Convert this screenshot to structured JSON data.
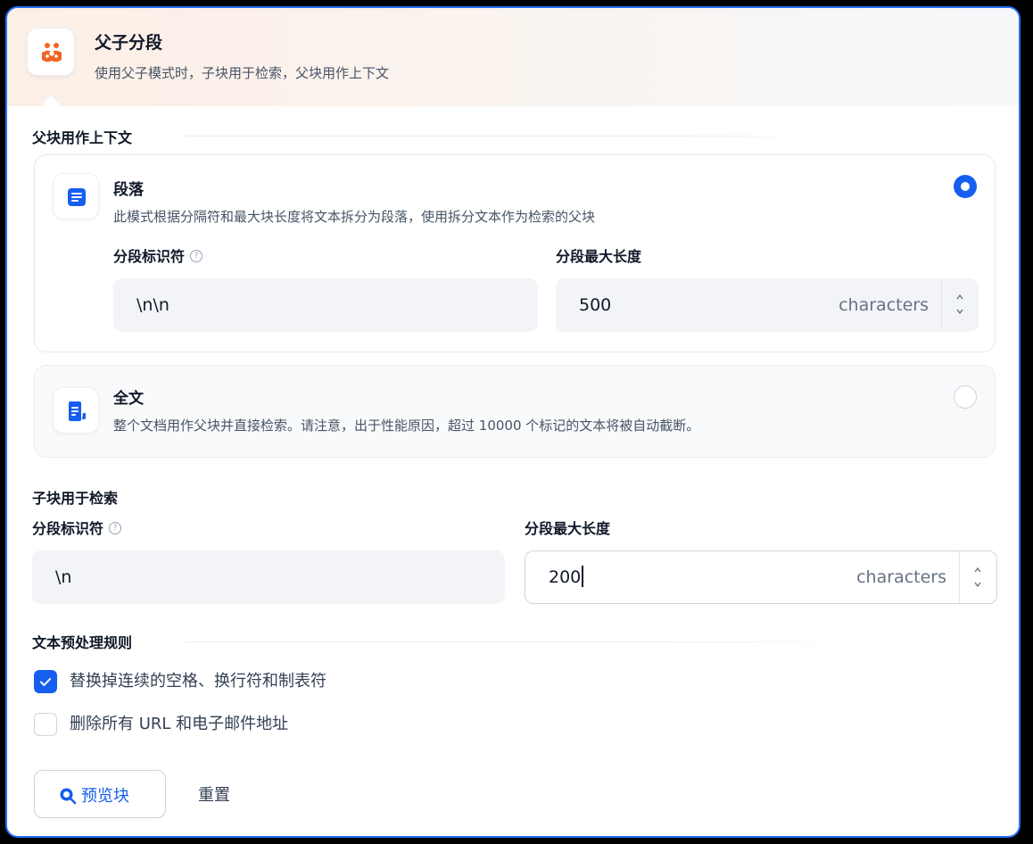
{
  "header": {
    "title": "父子分段",
    "description": "使用父子模式时，子块用于检索，父块用作上下文",
    "icon": "parent-child-icon",
    "accent_color": "#f06525"
  },
  "parent_section": {
    "title": "父块用作上下文",
    "options": [
      {
        "title": "段落",
        "description": "此模式根据分隔符和最大块长度将文本拆分为段落，使用拆分文本作为检索的父块",
        "icon": "paragraph-icon",
        "selected": true,
        "delimiter_label": "分段标识符",
        "delimiter_value": "\\n\\n",
        "max_length_label": "分段最大长度",
        "max_length_value": "500",
        "unit": "characters"
      },
      {
        "title": "全文",
        "description": "整个文档用作父块并直接检索。请注意，出于性能原因，超过 10000 个标记的文本将被自动截断。",
        "icon": "full-doc-icon",
        "selected": false
      }
    ]
  },
  "child_section": {
    "title": "子块用于检索",
    "delimiter_label": "分段标识符",
    "delimiter_value": "\\n",
    "max_length_label": "分段最大长度",
    "max_length_value": "200",
    "unit": "characters"
  },
  "preprocess": {
    "title": "文本预处理规则",
    "rules": [
      {
        "label": "替换掉连续的空格、换行符和制表符",
        "checked": true
      },
      {
        "label": "删除所有 URL 和电子邮件地址",
        "checked": false
      }
    ]
  },
  "actions": {
    "preview_label": "预览块",
    "reset_label": "重置"
  },
  "colors": {
    "primary": "#155eef",
    "border_focus": "#2970ff"
  }
}
